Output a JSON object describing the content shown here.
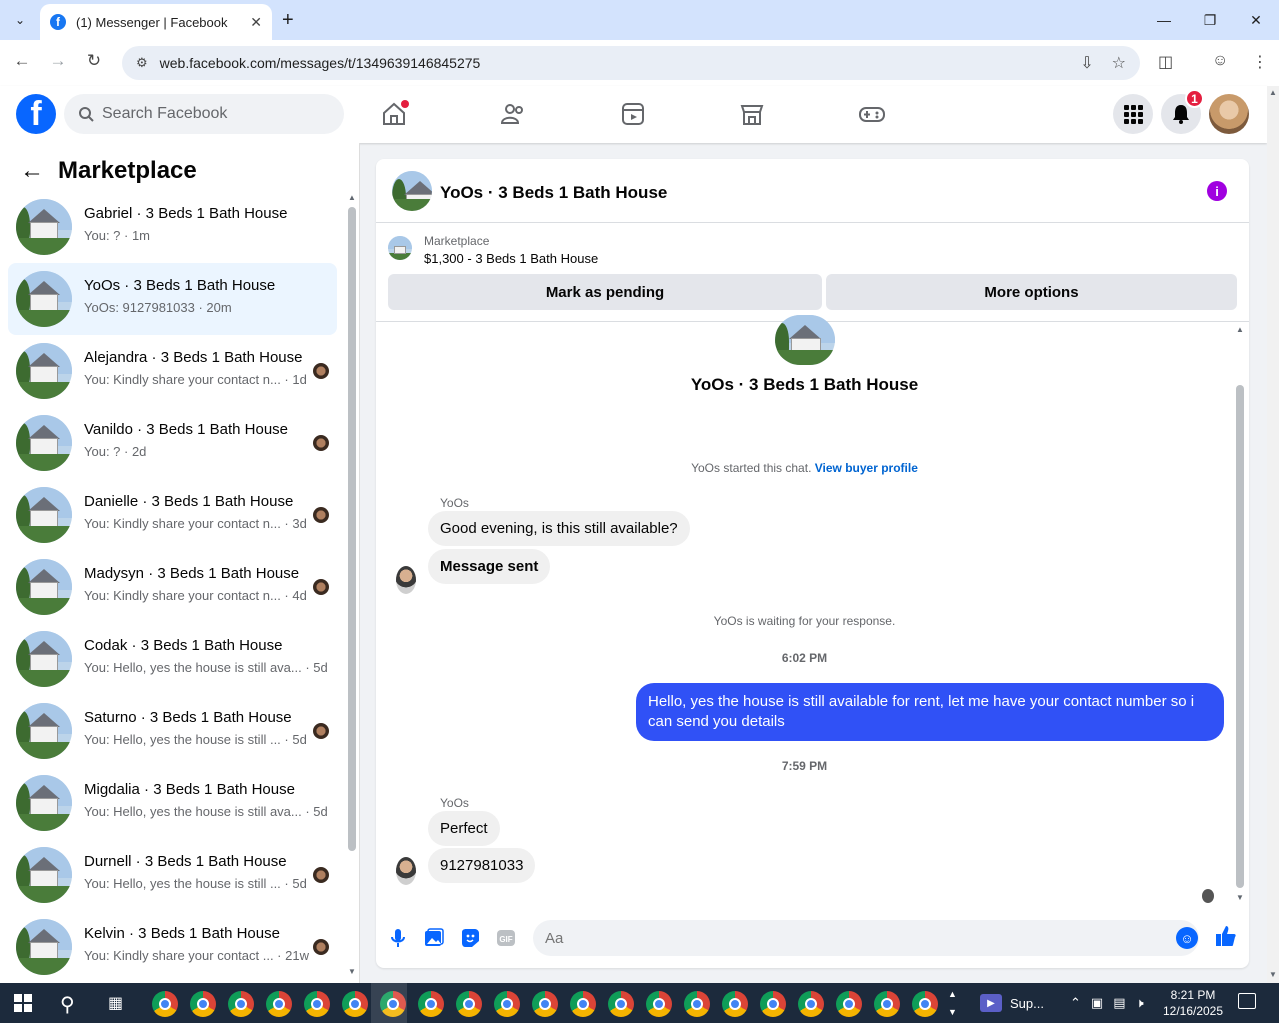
{
  "browser": {
    "tab_title": "(1) Messenger | Facebook",
    "url": "web.facebook.com/messages/t/1349639146845275"
  },
  "fb": {
    "search_placeholder": "Search Facebook",
    "notification_count": "1"
  },
  "left": {
    "title": "Marketplace",
    "conversations": [
      {
        "name": "Gabriel · 3 Beds 1 Bath House",
        "snippet": "You: ? · 1m",
        "active": false,
        "mini": false
      },
      {
        "name": "YoOs · 3 Beds 1 Bath House",
        "snippet": "YoOs: 9127981033 · 20m",
        "active": true,
        "mini": false
      },
      {
        "name": "Alejandra · 3 Beds 1 Bath House",
        "snippet": "You: Kindly share your contact n... · 1d",
        "active": false,
        "mini": true
      },
      {
        "name": "Vanildo · 3 Beds 1 Bath House",
        "snippet": "You: ? · 2d",
        "active": false,
        "mini": true
      },
      {
        "name": "Danielle · 3 Beds 1 Bath House",
        "snippet": "You: Kindly share your contact n... · 3d",
        "active": false,
        "mini": true
      },
      {
        "name": "Madysyn · 3 Beds 1 Bath House",
        "snippet": "You: Kindly share your contact n... · 4d",
        "active": false,
        "mini": true
      },
      {
        "name": "Codak · 3 Beds 1 Bath House",
        "snippet": "You: Hello, yes the house is still ava... · 5d",
        "active": false,
        "mini": false
      },
      {
        "name": "Saturno · 3 Beds 1 Bath House",
        "snippet": "You: Hello, yes the house is still ... · 5d",
        "active": false,
        "mini": true
      },
      {
        "name": "Migdalia · 3 Beds 1 Bath House",
        "snippet": "You: Hello, yes the house is still ava... · 5d",
        "active": false,
        "mini": false
      },
      {
        "name": "Durnell · 3 Beds 1 Bath House",
        "snippet": "You: Hello, yes the house is still ... · 5d",
        "active": false,
        "mini": true
      },
      {
        "name": "Kelvin · 3 Beds 1 Bath House",
        "snippet": "You: Kindly share your contact ... · 21w",
        "active": false,
        "mini": true
      }
    ]
  },
  "chat": {
    "title": "YoOs · 3 Beds 1 Bath House",
    "listing_label": "Marketplace",
    "listing_price": "$1,300 - 3 Beds 1 Bath House",
    "mark_pending": "Mark as pending",
    "more_options": "More options",
    "intro_title": "YoOs · 3 Beds 1 Bath House",
    "started_text": "YoOs started this chat. ",
    "view_profile": "View buyer profile",
    "sender1": "YoOs",
    "msg1": "Good evening, is this still available?",
    "msg2": "Message sent",
    "waiting": "YoOs is waiting for your response.",
    "time1": "6:02 PM",
    "out_msg": "Hello, yes the house is still available for rent, let me have your contact number so i can send you  details",
    "time2": "7:59 PM",
    "sender2": "YoOs",
    "msg3": "Perfect",
    "msg4": "9127981033",
    "composer_placeholder": "Aa"
  },
  "taskbar": {
    "app_label": "Sup...",
    "time": "8:21 PM",
    "date": "12/16/2025"
  }
}
